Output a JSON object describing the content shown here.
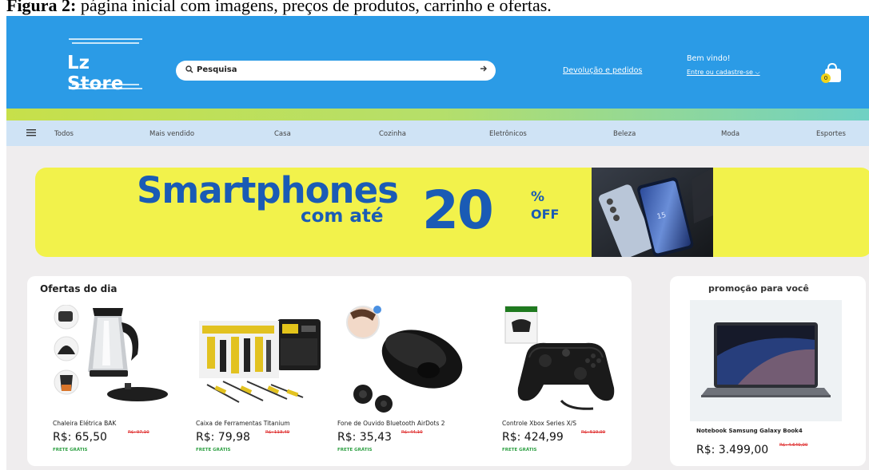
{
  "caption": {
    "label": "Figura 2:",
    "text": " página inicial com imagens, preços de produtos, carrinho e ofertas."
  },
  "header": {
    "logo": "Lz Store",
    "search_placeholder": "Pesquisa",
    "returns_link": "Devolução e  pedidos",
    "welcome": "Bem vindo!",
    "signin_link": "Entre ou cadastre-se",
    "cart_count": "0"
  },
  "nav": {
    "items": [
      "Todos",
      "Mais vendido",
      "Casa",
      "Cozinha",
      "Eletrônicos",
      "Beleza",
      "Moda",
      "Esportes"
    ]
  },
  "banner": {
    "title": "Smartphones",
    "subtitle": "com até",
    "number": "20",
    "percent": "%",
    "off": "OFF"
  },
  "offers": {
    "title": "Ofertas do dia",
    "products": [
      {
        "name": "Chaleira Elétrica BAK",
        "price": "R$: 65,50",
        "old_price": "R$: 97,10",
        "shipping": "FRETE GRÁTIS"
      },
      {
        "name": "Caixa de Ferramentas Titanium",
        "price": "R$: 79,98",
        "old_price": "R$: 113,49",
        "shipping": "FRETE GRÁTIS"
      },
      {
        "name": "Fone de Ouvido Bluetooth AirDots 2",
        "price": "R$: 35,43",
        "old_price": "R$: 44,10",
        "shipping": "FRETE GRÁTIS"
      },
      {
        "name": "Controle Xbox Series X/S",
        "price": "R$: 424,99",
        "old_price": "R$: 519,99",
        "shipping": "FRETE GRÁTIS"
      }
    ]
  },
  "promo": {
    "title": "promoção para você",
    "product_name": "Notebook Samsung Galaxy Book4",
    "price": "R$: 3.499,00",
    "old_price": "R$: 4.649,00"
  },
  "colors": {
    "header_blue": "#2b9be6",
    "nav_bg": "#cfe3f5",
    "banner_yellow": "#f2f24b",
    "banner_text": "#1a5bb5",
    "old_price_red": "#dd2222",
    "shipping_green": "#2ea043"
  }
}
